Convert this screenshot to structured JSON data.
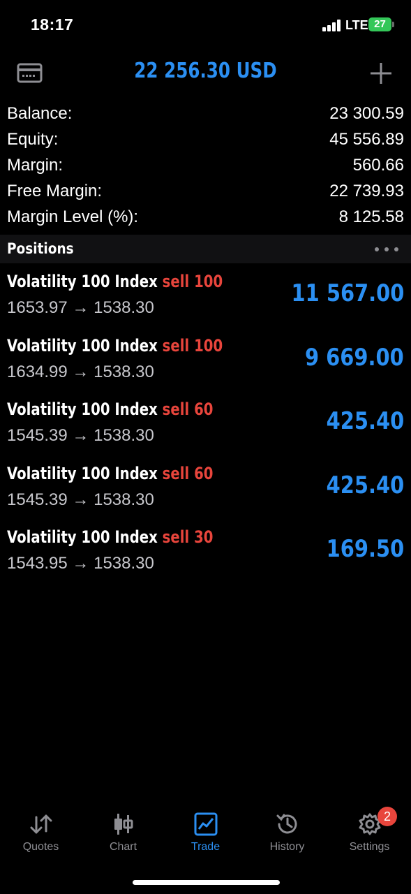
{
  "status_bar": {
    "time": "18:17",
    "network": "LTE",
    "battery": "27"
  },
  "header": {
    "title": "22 256.30 USD"
  },
  "summary": [
    {
      "label": "Balance:",
      "value": "23 300.59"
    },
    {
      "label": "Equity:",
      "value": "45 556.89"
    },
    {
      "label": "Margin:",
      "value": "560.66"
    },
    {
      "label": "Free Margin:",
      "value": "22 739.93"
    },
    {
      "label": "Margin Level (%):",
      "value": "8 125.58"
    }
  ],
  "positions_section": {
    "title": "Positions"
  },
  "positions": [
    {
      "symbol": "Volatility 100 Index",
      "type": "sell 100",
      "prices": "1653.97 → 1538.30",
      "profit": "11 567.00"
    },
    {
      "symbol": "Volatility 100 Index",
      "type": "sell 100",
      "prices": "1634.99 → 1538.30",
      "profit": "9 669.00"
    },
    {
      "symbol": "Volatility 100 Index",
      "type": "sell 60",
      "prices": "1545.39 → 1538.30",
      "profit": "425.40"
    },
    {
      "symbol": "Volatility 100 Index",
      "type": "sell 60",
      "prices": "1545.39 → 1538.30",
      "profit": "425.40"
    },
    {
      "symbol": "Volatility 100 Index",
      "type": "sell 30",
      "prices": "1543.95 → 1538.30",
      "profit": "169.50"
    }
  ],
  "tabs": [
    {
      "label": "Quotes",
      "icon": "quotes-arrows-icon",
      "active": false
    },
    {
      "label": "Chart",
      "icon": "candlestick-icon",
      "active": false
    },
    {
      "label": "Trade",
      "icon": "trade-chart-icon",
      "active": true
    },
    {
      "label": "History",
      "icon": "history-clock-icon",
      "active": false
    },
    {
      "label": "Settings",
      "icon": "gear-icon",
      "active": false
    }
  ],
  "settings_badge": "2",
  "colors": {
    "accent": "#2b8ff2",
    "sell": "#e8453c",
    "background": "#000000",
    "inactive": "#8e8e93"
  }
}
